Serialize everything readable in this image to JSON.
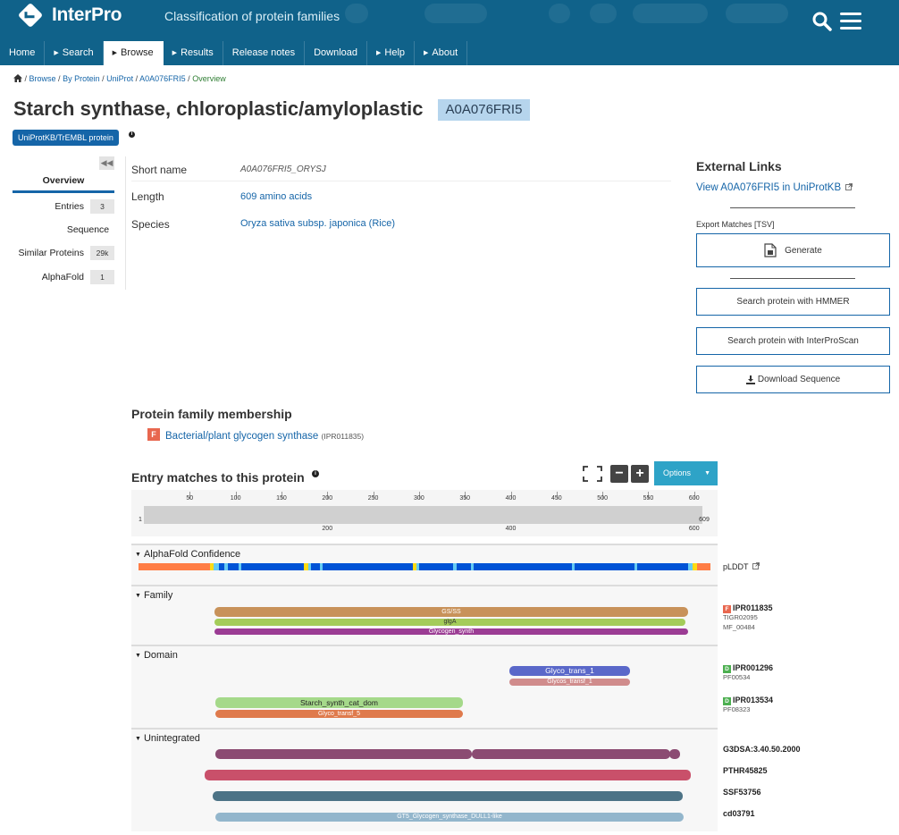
{
  "header": {
    "brand": "InterPro",
    "tagline": "Classification of protein families",
    "nav": [
      {
        "label": "Home",
        "caret": false,
        "active": false
      },
      {
        "label": "Search",
        "caret": true,
        "active": false
      },
      {
        "label": "Browse",
        "caret": true,
        "active": true
      },
      {
        "label": "Results",
        "caret": true,
        "active": false
      },
      {
        "label": "Release notes",
        "caret": false,
        "active": false
      },
      {
        "label": "Download",
        "caret": false,
        "active": false
      },
      {
        "label": "Help",
        "caret": true,
        "active": false
      },
      {
        "label": "About",
        "caret": true,
        "active": false
      }
    ]
  },
  "breadcrumb": {
    "items": [
      "Browse",
      "By Protein",
      "UniProt",
      "A0A076FRI5"
    ],
    "current": "Overview",
    "separator": "/"
  },
  "protein": {
    "title": "Starch synthase, chloroplastic/amyloplastic",
    "accession": "A0A076FRI5",
    "database_badge": "UniProtKB/TrEMBL protein"
  },
  "sidebar": {
    "active_tab": "Overview",
    "items": [
      {
        "label": "Entries",
        "count": "3"
      },
      {
        "label": "Sequence",
        "count": ""
      },
      {
        "label": "Similar Proteins",
        "count": "29k"
      },
      {
        "label": "AlphaFold",
        "count": "1"
      }
    ]
  },
  "overview": {
    "short_name_label": "Short name",
    "short_name": "A0A076FRI5_ORYSJ",
    "length_label": "Length",
    "length": "609 amino acids",
    "species_label": "Species",
    "species": "Oryza sativa subsp. japonica (Rice)"
  },
  "external": {
    "title": "External Links",
    "uniprot_link": "View A0A076FRI5 in UniProtKB",
    "export_label": "Export Matches [TSV]",
    "generate_button": "Generate",
    "hmmer_button": "Search protein with HMMER",
    "iprscan_button": "Search protein with InterProScan",
    "download_button": "Download Sequence"
  },
  "family": {
    "title": "Protein family membership",
    "badge": "F",
    "name": "Bacterial/plant glycogen synthase",
    "accession": "(IPR011835)"
  },
  "viewer": {
    "title": "Entry matches to this protein",
    "options_label": "Options",
    "ruler_ticks": [
      "50",
      "100",
      "150",
      "200",
      "250",
      "300",
      "350",
      "400",
      "450",
      "500",
      "550",
      "600"
    ],
    "ruler_start": "1",
    "ruler_end": "609",
    "overview_ticks": [
      "200",
      "400",
      "600"
    ],
    "sections": {
      "alphafold": "AlphaFold Confidence",
      "family": "Family",
      "domain": "Domain",
      "unintegrated": "Unintegrated"
    },
    "plddt_label": "pLDDT",
    "family_features": [
      {
        "label": "GS/SS",
        "color": "#c8925a"
      },
      {
        "label": "glgA",
        "color": "#a4cc5a"
      },
      {
        "label": "Glycogen_synth",
        "color": "#9b3c94"
      }
    ],
    "family_entry": {
      "badge": "F",
      "accession": "IPR011835",
      "members": [
        "TIGR02095",
        "MF_00484"
      ]
    },
    "domain_features": [
      {
        "label": "Glyco_trans_1",
        "color": "#5a68c9"
      },
      {
        "label": "Glycos_transf_1",
        "color": "#d08c8c"
      },
      {
        "label": "Starch_synth_cat_dom",
        "color": "#a5d98a"
      },
      {
        "label": "Glyco_transf_5",
        "color": "#df7a4c"
      }
    ],
    "domain_entries": [
      {
        "badge": "D",
        "accession": "IPR001296",
        "member": "PF00534"
      },
      {
        "badge": "D",
        "accession": "IPR013534",
        "member": "PF08323"
      }
    ],
    "unintegrated": [
      {
        "label": "G3DSA:3.40.50.2000",
        "color": "#8b4b72"
      },
      {
        "label": "PTHR45825",
        "color": "#c9506a"
      },
      {
        "label": "SSF53756",
        "color": "#4d7386"
      },
      {
        "label": "cd03791",
        "color": "#93b6cc",
        "feature_label": "GT5_Glycogen_synthase_DULL1-like"
      }
    ],
    "colors": {
      "family_badge": "#e8674f",
      "domain_badge": "#4caf50"
    }
  }
}
